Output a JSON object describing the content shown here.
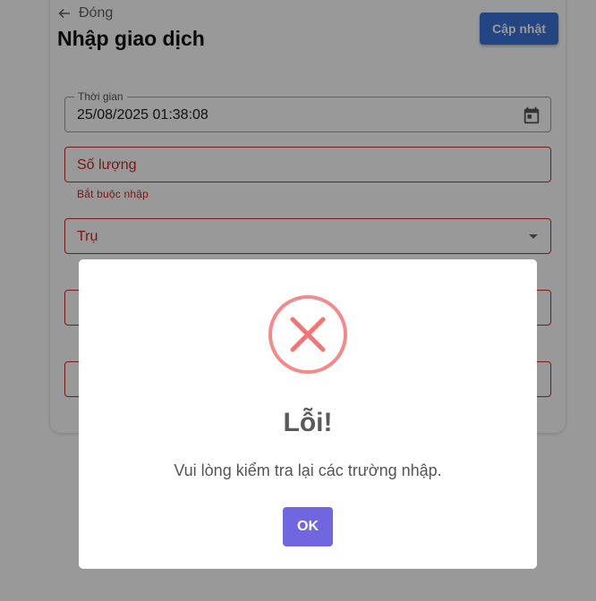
{
  "header": {
    "back_label": "Đóng",
    "title": "Nhập giao dịch",
    "update_button": "Cập nhật"
  },
  "form": {
    "time": {
      "label": "Thời gian",
      "value": "25/08/2025 01:38:08",
      "icon": "calendar-icon"
    },
    "quantity": {
      "placeholder": "Số lượng",
      "error": "Bắt buộc nhập"
    },
    "pillar": {
      "placeholder": "Trụ",
      "icon": "dropdown-arrow-icon"
    }
  },
  "dialog": {
    "icon": "error-x-icon",
    "title": "Lỗi!",
    "message": "Vui lòng kiểm tra lại các trường nhập.",
    "confirm_button": "OK"
  },
  "colors": {
    "primary": "#3b73d8",
    "error": "#c62828",
    "dialog_icon": "#f27474",
    "confirm": "#7066e0"
  }
}
